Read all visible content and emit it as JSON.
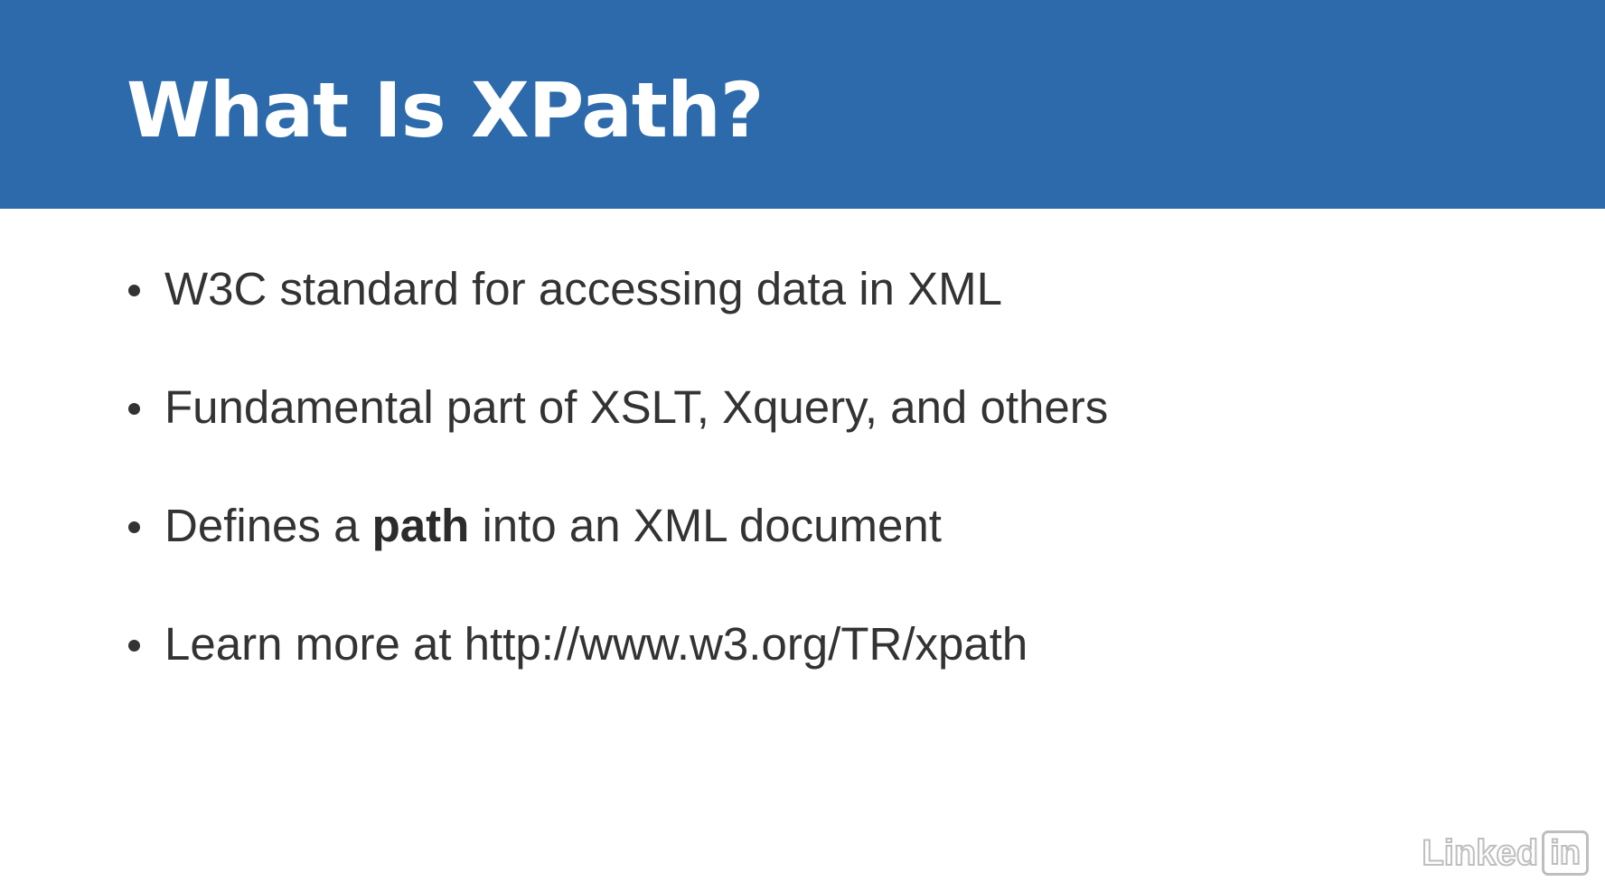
{
  "slide": {
    "title": "What Is XPath?",
    "bullets": [
      {
        "text": "W3C standard for accessing data in XML"
      },
      {
        "text": "Fundamental part of XSLT, Xquery, and others"
      },
      {
        "before": "Defines a ",
        "bold": "path",
        "after": " into an XML document"
      },
      {
        "text": "Learn more at http://www.w3.org/TR/xpath"
      }
    ]
  },
  "logo": {
    "word": "Linked",
    "box": "in"
  },
  "colors": {
    "header": "#2d6aab",
    "body_text": "#333333",
    "background": "#ffffff"
  }
}
